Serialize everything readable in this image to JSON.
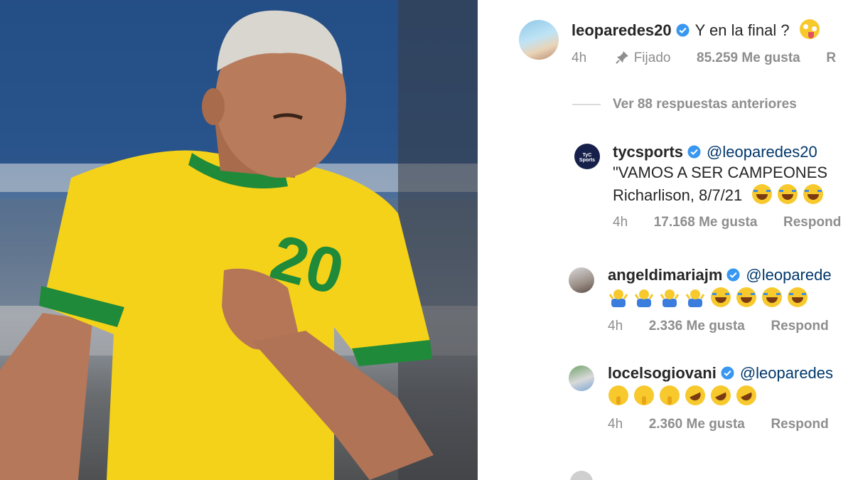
{
  "post_image": {
    "subject": "player-kissing-jersey",
    "jersey_color": "#f5d21a",
    "trim_color": "#1f8a3a",
    "jersey_number": "20"
  },
  "comments_panel": {
    "pinned_comment": {
      "username": "leoparedes20",
      "text": "Y en la final ?",
      "emoji": "zany-face-emoji",
      "time": "4h",
      "pinned_label": "Fijado",
      "likes": "85.259 Me gusta",
      "reply_truncated": "R"
    },
    "view_replies": "Ver 88 respuestas anteriores",
    "replies": [
      {
        "username": "tycsports",
        "avatar_text": "TyC Sports",
        "mention": "@leoparedes20",
        "line1": "\"VAMOS A SER CAMPEONES",
        "line2": "Richarlison, 8/7/21",
        "emojis": [
          "laugh",
          "laugh",
          "laugh"
        ],
        "time": "4h",
        "likes": "17.168 Me gusta",
        "reply": "Respond"
      },
      {
        "username": "angeldimariajm",
        "mention": "@leoparede",
        "emojis": [
          "shrug",
          "shrug",
          "shrug",
          "shrug",
          "laugh",
          "laugh",
          "laugh",
          "laugh"
        ],
        "time": "4h",
        "likes": "2.336 Me gusta",
        "reply": "Respond"
      },
      {
        "username": "locelsogiovani",
        "mention": "@leoparedes",
        "emojis": [
          "shush",
          "shush",
          "shush",
          "rofl",
          "rofl",
          "rofl"
        ],
        "time": "4h",
        "likes": "2.360 Me gusta",
        "reply": "Respond"
      }
    ]
  },
  "colors": {
    "username": "#262626",
    "mention": "#00376b",
    "meta": "#8e8e8e",
    "verified": "#3897f0"
  }
}
